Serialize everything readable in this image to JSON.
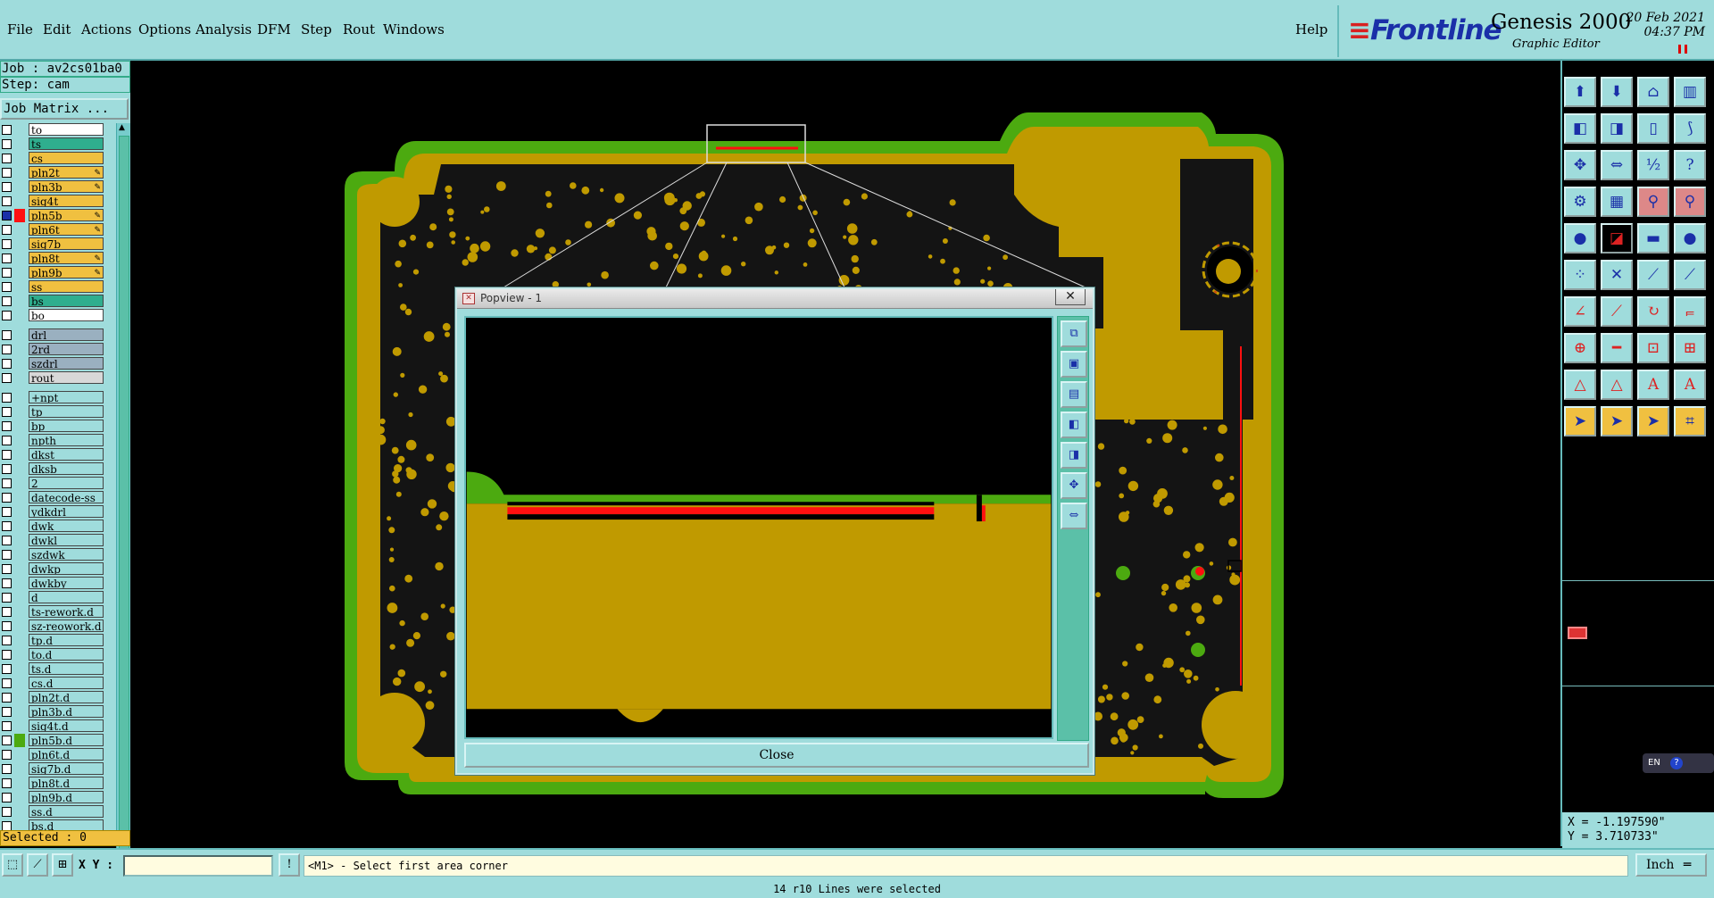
{
  "menu": {
    "file": "File",
    "edit": "Edit",
    "actions": "Actions",
    "options": "Options",
    "analysis": "Analysis",
    "dfm": "DFM",
    "step": "Step",
    "rout": "Rout",
    "windows": "Windows",
    "help": "Help"
  },
  "brand": {
    "logo": "Frontline",
    "product": "Genesis 2000",
    "subtitle": "Graphic Editor",
    "date": "20 Feb 2021",
    "time": "04:37 PM"
  },
  "left": {
    "job": "Job : av2cs01ba0",
    "step": "Step: cam",
    "job_matrix": "Job Matrix ...",
    "selected": "Selected : 0",
    "layers": [
      {
        "name": "to",
        "color": "#ffffff"
      },
      {
        "name": "ts",
        "color": "#2fae8e"
      },
      {
        "name": "cs",
        "color": "#f0c040"
      },
      {
        "name": "pln2t",
        "color": "#f0c040",
        "aff": true
      },
      {
        "name": "pln3b",
        "color": "#f0c040",
        "aff": true
      },
      {
        "name": "sig4t",
        "color": "#f0c040"
      },
      {
        "name": "pln5b",
        "color": "#f0c040",
        "aff": true,
        "active": true
      },
      {
        "name": "pln6t",
        "color": "#f0c040",
        "aff": true
      },
      {
        "name": "sig7b",
        "color": "#f0c040"
      },
      {
        "name": "pln8t",
        "color": "#f0c040",
        "aff": true
      },
      {
        "name": "pln9b",
        "color": "#f0c040",
        "aff": true
      },
      {
        "name": "ss",
        "color": "#f0c040"
      },
      {
        "name": "bs",
        "color": "#2fae8e"
      },
      {
        "name": "bo",
        "color": "#ffffff"
      },
      {
        "name": "drl",
        "color": "#9ab0c0",
        "gap": true
      },
      {
        "name": "2rd",
        "color": "#9ab0c0"
      },
      {
        "name": "szdrl",
        "color": "#9ab0c0"
      },
      {
        "name": "rout",
        "color": "#d8d8d8"
      },
      {
        "name": "+npt",
        "color": "#9fdcdc",
        "gap": true
      },
      {
        "name": "tp",
        "color": "#9fdcdc"
      },
      {
        "name": "bp",
        "color": "#9fdcdc"
      },
      {
        "name": "npth",
        "color": "#9fdcdc"
      },
      {
        "name": "dkst",
        "color": "#9fdcdc"
      },
      {
        "name": "dksb",
        "color": "#9fdcdc"
      },
      {
        "name": "2",
        "color": "#9fdcdc"
      },
      {
        "name": "datecode-ss",
        "color": "#9fdcdc"
      },
      {
        "name": "ydkdrl",
        "color": "#9fdcdc"
      },
      {
        "name": "dwk",
        "color": "#9fdcdc"
      },
      {
        "name": "dwkl",
        "color": "#9fdcdc"
      },
      {
        "name": "szdwk",
        "color": "#9fdcdc"
      },
      {
        "name": "dwkp",
        "color": "#9fdcdc"
      },
      {
        "name": "dwkby",
        "color": "#9fdcdc"
      },
      {
        "name": "d",
        "color": "#9fdcdc"
      },
      {
        "name": "ts-rework.d",
        "color": "#9fdcdc"
      },
      {
        "name": "sz-reowork.d",
        "color": "#9fdcdc"
      },
      {
        "name": "tp.d",
        "color": "#9fdcdc"
      },
      {
        "name": "to.d",
        "color": "#9fdcdc"
      },
      {
        "name": "ts.d",
        "color": "#9fdcdc"
      },
      {
        "name": "cs.d",
        "color": "#9fdcdc"
      },
      {
        "name": "pln2t.d",
        "color": "#9fdcdc"
      },
      {
        "name": "pln3b.d",
        "color": "#9fdcdc"
      },
      {
        "name": "sig4t.d",
        "color": "#9fdcdc"
      },
      {
        "name": "pln5b.d",
        "color": "#9fdcdc",
        "green": true
      },
      {
        "name": "pln6t.d",
        "color": "#9fdcdc"
      },
      {
        "name": "sig7b.d",
        "color": "#9fdcdc"
      },
      {
        "name": "pln8t.d",
        "color": "#9fdcdc"
      },
      {
        "name": "pln9b.d",
        "color": "#9fdcdc"
      },
      {
        "name": "ss.d",
        "color": "#9fdcdc"
      },
      {
        "name": "bs.d",
        "color": "#9fdcdc"
      }
    ]
  },
  "popview": {
    "title": "Popview - 1",
    "close": "Close"
  },
  "right": {
    "x": "X = -1.197590\"",
    "y": "Y = 3.710733\"",
    "lang": "EN"
  },
  "bottom": {
    "xy_label": "X Y :",
    "xy_value": "",
    "prompt": "<M1> - Select first area corner",
    "units": "Inch",
    "status": "14 r10 Lines were selected"
  },
  "colors": {
    "copper": "#c09a00",
    "board_edge": "#4caa10",
    "ui": "#9fdcdc",
    "highlight": "#f0c040",
    "selected": "#ff1010"
  }
}
